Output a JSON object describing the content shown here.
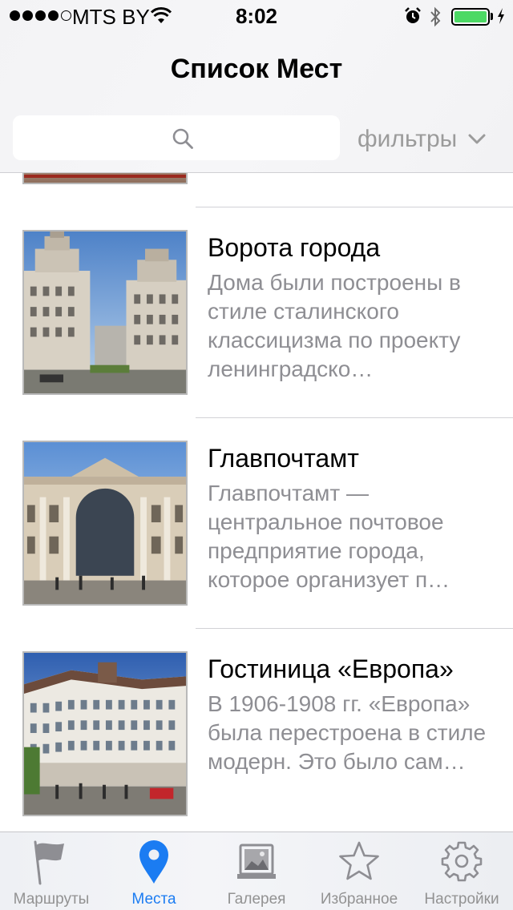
{
  "status_bar": {
    "carrier": "MTS BY",
    "time": "8:02",
    "signal_bars_filled": 4,
    "signal_bars_total": 5,
    "battery_level": 1.0,
    "battery_color": "#4cd964"
  },
  "nav": {
    "title": "Список Мест"
  },
  "search": {
    "placeholder": "",
    "value": "",
    "filters_label": "фильтры"
  },
  "places": [
    {
      "title": "Ворота города",
      "description": "Дома были построены в стиле сталинского классицизма по проекту ленинградско…"
    },
    {
      "title": "Главпочтамт",
      "description": "Главпочтамт — центральное почтовое предприятие города, которое организует п…"
    },
    {
      "title": "Гостиница «Европа»",
      "description": "В 1906-1908 гг. «Европа» была перестроена в стиле модерн. Это было сам…"
    }
  ],
  "tabbar": {
    "items": [
      {
        "label": "Маршруты",
        "icon": "flag-icon",
        "active": false
      },
      {
        "label": "Места",
        "icon": "location-pin-icon",
        "active": true
      },
      {
        "label": "Галерея",
        "icon": "gallery-icon",
        "active": false
      },
      {
        "label": "Избранное",
        "icon": "star-icon",
        "active": false
      },
      {
        "label": "Настройки",
        "icon": "gear-icon",
        "active": false
      }
    ],
    "active_color": "#1b7cf2",
    "inactive_color": "#929292"
  }
}
